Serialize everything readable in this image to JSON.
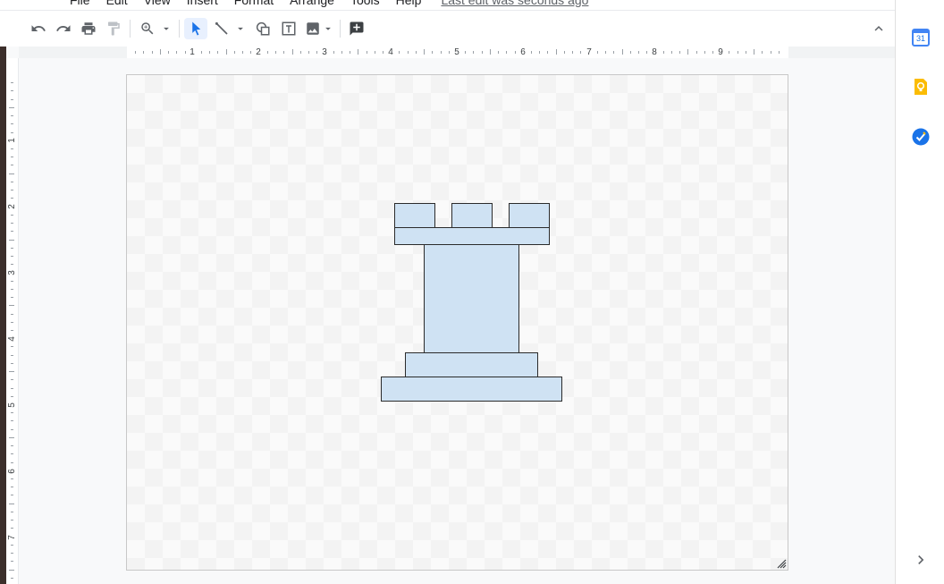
{
  "menu": {
    "items": [
      "File",
      "Edit",
      "View",
      "Insert",
      "Format",
      "Arrange",
      "Tools",
      "Help"
    ],
    "last_edit": "Last edit was seconds ago"
  },
  "toolbar": {
    "buttons": [
      "undo-icon",
      "redo-icon",
      "print-icon",
      "paint-format-icon",
      "zoom-icon",
      "select-icon",
      "line-icon",
      "shape-icon",
      "text-box-icon",
      "image-icon",
      "add-comment-icon"
    ],
    "collapse": "chevron-up-icon"
  },
  "ruler": {
    "horizontal": [
      "1",
      "2",
      "3",
      "4",
      "5",
      "6",
      "7",
      "8",
      "9"
    ],
    "vertical": [
      "1",
      "2",
      "3",
      "4",
      "5",
      "6",
      "7"
    ]
  },
  "sidepanel": {
    "calendar_day": "31",
    "icons": [
      "calendar-icon",
      "keep-icon",
      "tasks-icon",
      "expand-icon"
    ]
  },
  "colors": {
    "shape_fill": "#cfe2f3",
    "shape_stroke": "#2b2b2b",
    "selection_accent": "#1a73e8"
  }
}
